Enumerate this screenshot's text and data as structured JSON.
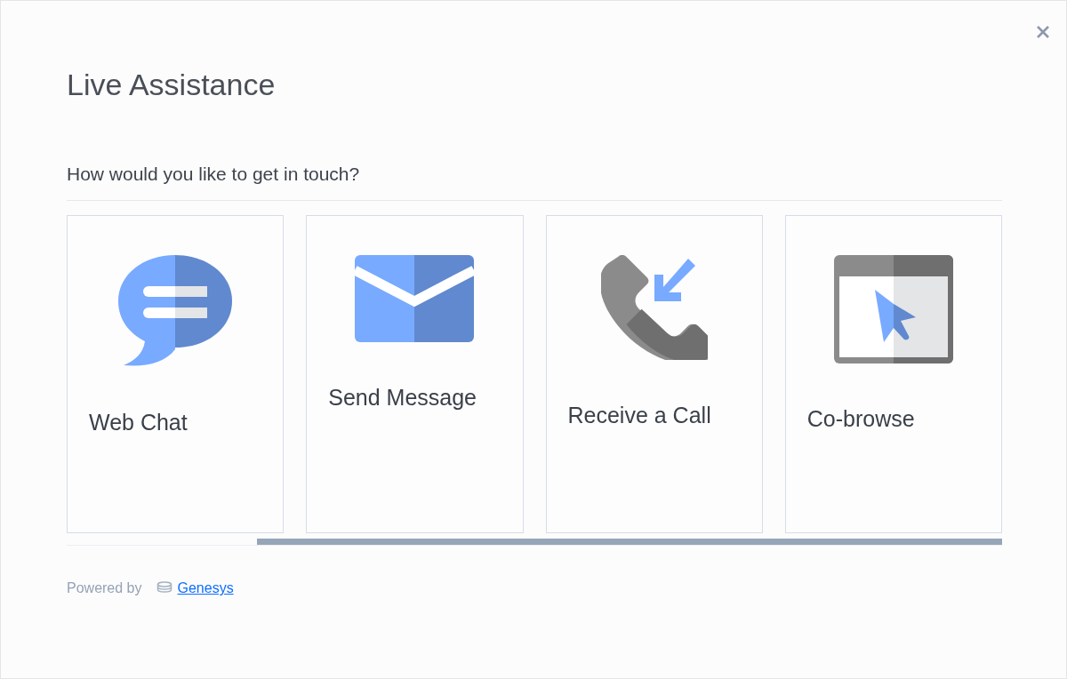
{
  "dialog": {
    "title": "Live Assistance",
    "prompt": "How would you like to get in touch?"
  },
  "options": [
    {
      "kind": "chat",
      "label": "Web Chat"
    },
    {
      "kind": "message",
      "label": "Send Message"
    },
    {
      "kind": "call",
      "label": "Receive a Call"
    },
    {
      "kind": "cobrowse",
      "label": "Co-browse"
    }
  ],
  "footer": {
    "prefix": "Powered by",
    "brand": "Genesys"
  }
}
